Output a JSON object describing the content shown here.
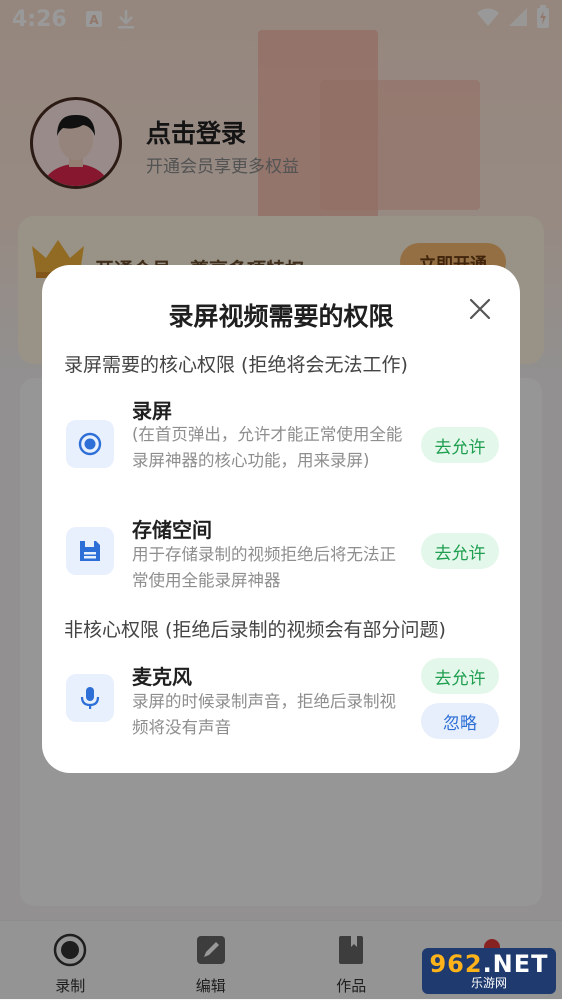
{
  "status_bar": {
    "time": "4:26"
  },
  "profile": {
    "login_title": "点击登录",
    "login_subtitle": "开通会员享更多权益"
  },
  "vip_card": {
    "text": "开通会员，尊享多项特权",
    "button": "立即开通"
  },
  "dialog": {
    "title": "录屏视频需要的权限",
    "core_section": "录屏需要的核心权限 (拒绝将会无法工作)",
    "noncore_section": "非核心权限 (拒绝后录制的视频会有部分问题)",
    "permissions": [
      {
        "name": "录屏",
        "description": "(在首页弹出，允许才能正常使用全能录屏神器的核心功能，用来录屏)",
        "allow_label": "去允许",
        "icon": "record-icon"
      },
      {
        "name": "存储空间",
        "description": "用于存储录制的视频拒绝后将无法正常使用全能录屏神器",
        "allow_label": "去允许",
        "icon": "storage-icon"
      },
      {
        "name": "麦克风",
        "description": "录屏的时候录制声音，拒绝后录制视频将没有声音",
        "allow_label": "去允许",
        "ignore_label": "忽略",
        "icon": "microphone-icon"
      }
    ]
  },
  "tab_bar": {
    "tabs": [
      {
        "label": "录制",
        "icon": "record-tab-icon"
      },
      {
        "label": "编辑",
        "icon": "edit-tab-icon"
      },
      {
        "label": "作品",
        "icon": "works-tab-icon"
      }
    ]
  },
  "watermark": {
    "main_digits": "962",
    "main_suffix": ".NET",
    "sub": "乐游网"
  },
  "colors": {
    "accent_blue": "#2d6fd6",
    "allow_green": "#1e9e4f",
    "overlay": "rgba(0,0,0,0.40)"
  }
}
